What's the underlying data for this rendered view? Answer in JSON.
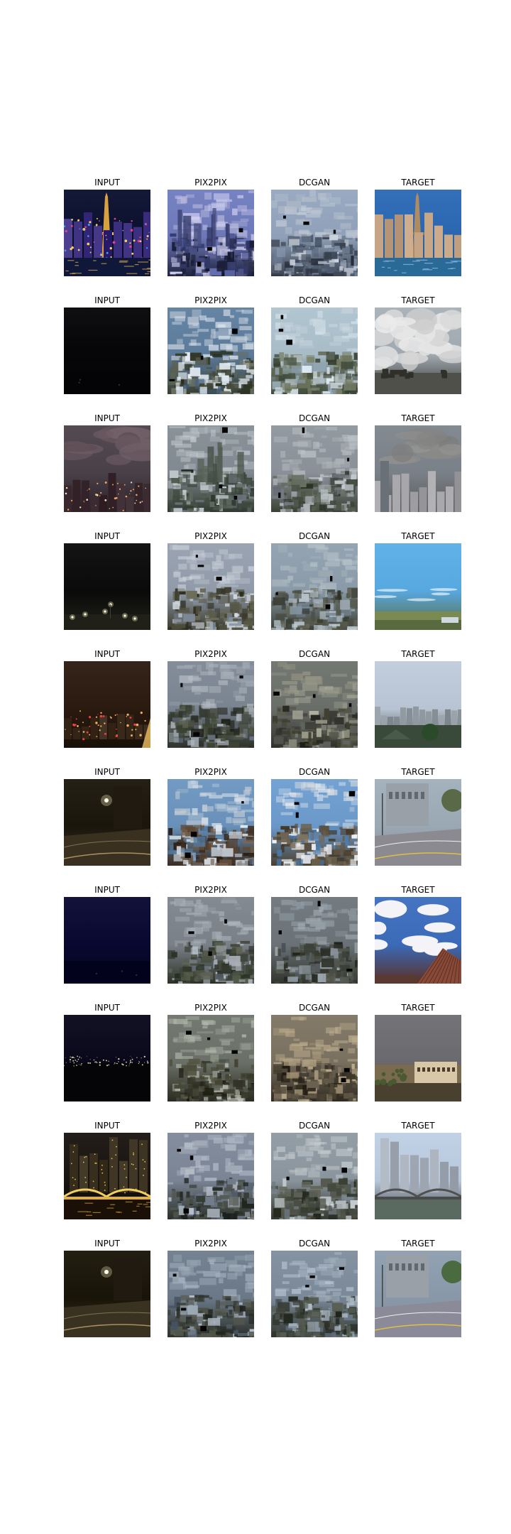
{
  "grid": {
    "rows": [
      {
        "cells": [
          {
            "title": "INPUT",
            "scene": "night-paris-casino",
            "palette": {
              "bg": "#0a0f2e",
              "accent": "#e4b84a",
              "mid": "#3a2c7c",
              "low": "#101018"
            }
          },
          {
            "title": "PIX2PIX",
            "scene": "generated-city",
            "palette": {
              "bg": "#6d78b8",
              "accent": "#c8c8e8",
              "mid": "#3c4272",
              "low": "#20243e"
            }
          },
          {
            "title": "DCGAN",
            "scene": "generated-blur",
            "palette": {
              "bg": "#8fa0b8",
              "accent": "#c0c8d4",
              "mid": "#58667a",
              "low": "#3a4250"
            }
          },
          {
            "title": "TARGET",
            "scene": "day-paris-casino",
            "palette": {
              "bg": "#2a66b0",
              "accent": "#c89a6a",
              "mid": "#6a5a4a",
              "low": "#2a5a80"
            }
          }
        ]
      },
      {
        "cells": [
          {
            "title": "INPUT",
            "scene": "dark-sky",
            "palette": {
              "bg": "#050508",
              "accent": "#101014",
              "mid": "#0a0a0e",
              "low": "#08080a"
            }
          },
          {
            "title": "PIX2PIX",
            "scene": "generated-sky",
            "palette": {
              "bg": "#5c7a9a",
              "accent": "#d8e0e8",
              "mid": "#6a7060",
              "low": "#3a4030"
            }
          },
          {
            "title": "DCGAN",
            "scene": "generated-sky",
            "palette": {
              "bg": "#a8bcc8",
              "accent": "#ccd8e0",
              "mid": "#707860",
              "low": "#404a3a"
            }
          },
          {
            "title": "TARGET",
            "scene": "cloudy-sky",
            "palette": {
              "bg": "#a0a8b0",
              "accent": "#f0f0f0",
              "mid": "#50504a",
              "low": "#30302a"
            }
          }
        ]
      },
      {
        "cells": [
          {
            "title": "INPUT",
            "scene": "dusk-city",
            "palette": {
              "bg": "#4a4048",
              "accent": "#e8a070",
              "mid": "#6a5860",
              "low": "#2a2028"
            }
          },
          {
            "title": "PIX2PIX",
            "scene": "generated-city",
            "palette": {
              "bg": "#808890",
              "accent": "#c0c8cc",
              "mid": "#505a50",
              "low": "#303a30"
            }
          },
          {
            "title": "DCGAN",
            "scene": "generated-blur",
            "palette": {
              "bg": "#8a9098",
              "accent": "#b8c0c4",
              "mid": "#5a6256",
              "low": "#3a4236"
            }
          },
          {
            "title": "TARGET",
            "scene": "overcast-city",
            "palette": {
              "bg": "#7a8088",
              "accent": "#c8ccd0",
              "mid": "#8a8a88",
              "low": "#5a5a58"
            }
          }
        ]
      },
      {
        "cells": [
          {
            "title": "INPUT",
            "scene": "night-lights",
            "palette": {
              "bg": "#0a0a0a",
              "accent": "#f0f0c0",
              "mid": "#141410",
              "low": "#202018"
            }
          },
          {
            "title": "PIX2PIX",
            "scene": "generated-blur",
            "palette": {
              "bg": "#909aa8",
              "accent": "#c8d0d8",
              "mid": "#5a5a48",
              "low": "#3a3a2c"
            }
          },
          {
            "title": "DCGAN",
            "scene": "generated-blur",
            "palette": {
              "bg": "#8a9aa8",
              "accent": "#b0bcc4",
              "mid": "#5a5e50",
              "low": "#3a3e34"
            }
          },
          {
            "title": "TARGET",
            "scene": "blue-sky-field",
            "palette": {
              "bg": "#58a8e0",
              "accent": "#e8f4fa",
              "mid": "#7a8a50",
              "low": "#5a6a40"
            }
          }
        ]
      },
      {
        "cells": [
          {
            "title": "INPUT",
            "scene": "night-town",
            "palette": {
              "bg": "#2a1a10",
              "accent": "#f0b060",
              "mid": "#3a2a1c",
              "low": "#181008"
            }
          },
          {
            "title": "PIX2PIX",
            "scene": "generated-blur",
            "palette": {
              "bg": "#7a8490",
              "accent": "#a8b0b8",
              "mid": "#4a5040",
              "low": "#2c3028"
            }
          },
          {
            "title": "DCGAN",
            "scene": "generated-blur",
            "palette": {
              "bg": "#6a6e68",
              "accent": "#a0a090",
              "mid": "#4a4a3c",
              "low": "#30302a"
            }
          },
          {
            "title": "TARGET",
            "scene": "day-town",
            "palette": {
              "bg": "#b8c4d4",
              "accent": "#eef2f8",
              "mid": "#707a70",
              "low": "#3a4a3a"
            }
          }
        ]
      },
      {
        "cells": [
          {
            "title": "INPUT",
            "scene": "night-street",
            "palette": {
              "bg": "#1a160c",
              "accent": "#e8e0b0",
              "mid": "#28221a",
              "low": "#3a3020"
            }
          },
          {
            "title": "PIX2PIX",
            "scene": "generated-sky",
            "palette": {
              "bg": "#6890b8",
              "accent": "#d0d8e0",
              "mid": "#6a5440",
              "low": "#3a2c20"
            }
          },
          {
            "title": "DCGAN",
            "scene": "generated-sky",
            "palette": {
              "bg": "#6a98c8",
              "accent": "#e0e4e8",
              "mid": "#706450",
              "low": "#4a4030"
            }
          },
          {
            "title": "TARGET",
            "scene": "day-street",
            "palette": {
              "bg": "#9aa8b4",
              "accent": "#d8d8d8",
              "mid": "#5a6a48",
              "low": "#8a8a90"
            }
          }
        ]
      },
      {
        "cells": [
          {
            "title": "INPUT",
            "scene": "dark-blue",
            "palette": {
              "bg": "#080830",
              "accent": "#101040",
              "mid": "#0a0a28",
              "low": "#060620"
            }
          },
          {
            "title": "PIX2PIX",
            "scene": "generated-blur",
            "palette": {
              "bg": "#7a8088",
              "accent": "#a8b0b8",
              "mid": "#4a5040",
              "low": "#2c3228"
            }
          },
          {
            "title": "DCGAN",
            "scene": "generated-blur",
            "palette": {
              "bg": "#6a7278",
              "accent": "#9aa4ac",
              "mid": "#4a4e44",
              "low": "#30342c"
            }
          },
          {
            "title": "TARGET",
            "scene": "clouds-roof",
            "palette": {
              "bg": "#3a6ab8",
              "accent": "#f4f4f8",
              "mid": "#8a4a38",
              "low": "#5a3024"
            }
          }
        ]
      },
      {
        "cells": [
          {
            "title": "INPUT",
            "scene": "night-horizon",
            "palette": {
              "bg": "#08081a",
              "accent": "#d0c8a0",
              "mid": "#0c0c14",
              "low": "#050508"
            }
          },
          {
            "title": "PIX2PIX",
            "scene": "generated-blur",
            "palette": {
              "bg": "#6a7068",
              "accent": "#b0b4a8",
              "mid": "#4a4a38",
              "low": "#2a2a20"
            }
          },
          {
            "title": "DCGAN",
            "scene": "generated-blur",
            "palette": {
              "bg": "#7a7060",
              "accent": "#b8a888",
              "mid": "#504838",
              "low": "#302a20"
            }
          },
          {
            "title": "TARGET",
            "scene": "dusk-building",
            "palette": {
              "bg": "#6a6a6e",
              "accent": "#d8c8a8",
              "mid": "#7a6a50",
              "low": "#4a4030"
            }
          }
        ]
      },
      {
        "cells": [
          {
            "title": "INPUT",
            "scene": "night-bridge",
            "palette": {
              "bg": "#1a1410",
              "accent": "#f0c850",
              "mid": "#3a3020",
              "low": "#0a0808"
            }
          },
          {
            "title": "PIX2PIX",
            "scene": "generated-blur",
            "palette": {
              "bg": "#7a8494",
              "accent": "#b8c0cc",
              "mid": "#4a5048",
              "low": "#2a302a"
            }
          },
          {
            "title": "DCGAN",
            "scene": "generated-blur",
            "palette": {
              "bg": "#8a949c",
              "accent": "#c0c8cc",
              "mid": "#54584c",
              "low": "#34382e"
            }
          },
          {
            "title": "TARGET",
            "scene": "day-bridge",
            "palette": {
              "bg": "#b8c8dc",
              "accent": "#e8eef4",
              "mid": "#6a6860",
              "low": "#3a3e38"
            }
          }
        ]
      },
      {
        "cells": [
          {
            "title": "INPUT",
            "scene": "night-street",
            "palette": {
              "bg": "#181408",
              "accent": "#d8d0a0",
              "mid": "#28221a",
              "low": "#3a3220"
            }
          },
          {
            "title": "PIX2PIX",
            "scene": "generated-blur",
            "palette": {
              "bg": "#6a7888",
              "accent": "#a8b4c0",
              "mid": "#4a4e44",
              "low": "#2c302a"
            }
          },
          {
            "title": "DCGAN",
            "scene": "generated-blur",
            "palette": {
              "bg": "#7a8898",
              "accent": "#b0bcc8",
              "mid": "#50564c",
              "low": "#323830"
            }
          },
          {
            "title": "TARGET",
            "scene": "day-street",
            "palette": {
              "bg": "#8898a8",
              "accent": "#c8ccd0",
              "mid": "#4a6a40",
              "low": "#8a8a98"
            }
          }
        ]
      }
    ]
  }
}
